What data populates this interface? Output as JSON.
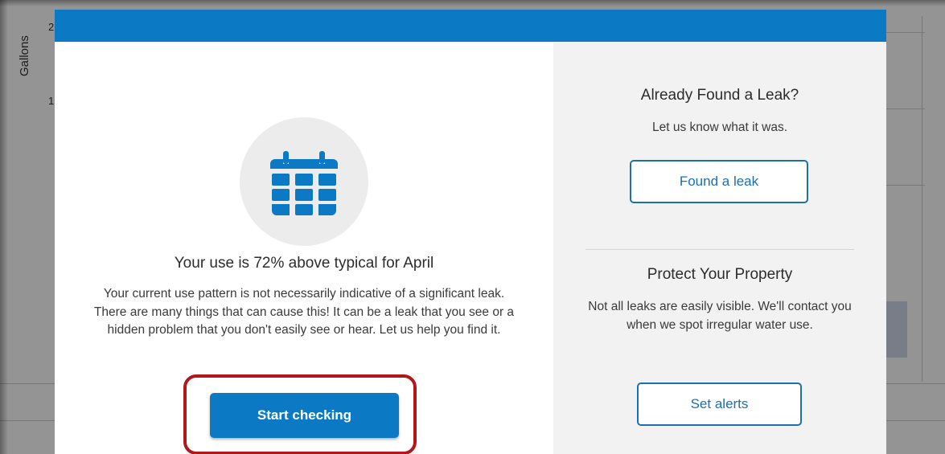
{
  "background": {
    "axis_label": "Gallons",
    "ticks": [
      "2",
      "1"
    ]
  },
  "modal": {
    "header_color": "#0b79c4",
    "left": {
      "icon": "calendar-icon",
      "headline": "Your use is 72% above typical for April",
      "body": "Your current use pattern is not necessarily indicative of a significant leak. There are many things that can cause this! It can be a leak that you see or a hidden problem that you don't easily see or hear. Let us help you find it.",
      "primary_button": "Start checking"
    },
    "right": {
      "found_leak": {
        "title": "Already Found a Leak?",
        "text": "Let us know what it was.",
        "button": "Found a leak"
      },
      "protect": {
        "title": "Protect Your Property",
        "text": "Not all leaks are easily visible. We'll contact you when we spot irregular water use.",
        "button": "Set alerts"
      }
    }
  },
  "colors": {
    "accent": "#0b79c4",
    "highlight": "#b3161b",
    "panel": "#f2f2f2"
  }
}
